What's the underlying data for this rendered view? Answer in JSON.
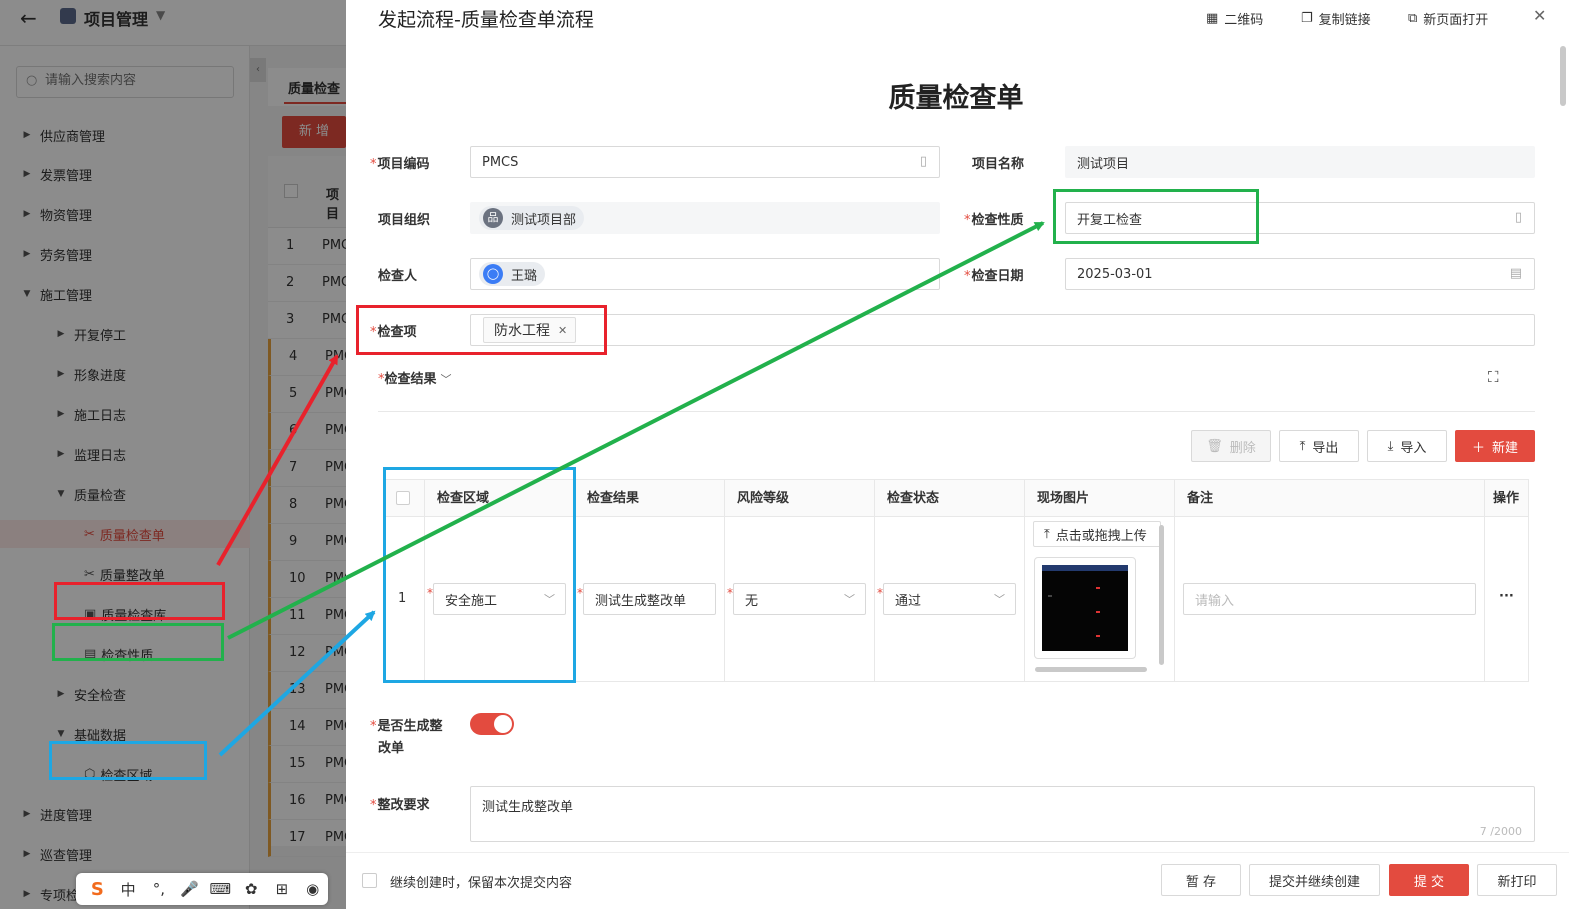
{
  "app": {
    "back_icon": "arrow-left-icon",
    "title": "项目管理",
    "search_placeholder": "请输入搜索内容",
    "tab_label": "质量检查",
    "new_button": "新 增",
    "table_header_col": "项目",
    "row_prefix": "PMC",
    "rows": [
      "1",
      "2",
      "3",
      "4",
      "5",
      "6",
      "7",
      "8",
      "9",
      "10",
      "11",
      "12",
      "13",
      "14",
      "15",
      "16",
      "17"
    ],
    "nav": [
      {
        "label": "供应商管理",
        "level": 0,
        "state": "collapsed"
      },
      {
        "label": "发票管理",
        "level": 0,
        "state": "collapsed"
      },
      {
        "label": "物资管理",
        "level": 0,
        "state": "collapsed"
      },
      {
        "label": "劳务管理",
        "level": 0,
        "state": "collapsed"
      },
      {
        "label": "施工管理",
        "level": 0,
        "state": "expanded"
      },
      {
        "label": "开复停工",
        "level": 1,
        "state": "collapsed"
      },
      {
        "label": "形象进度",
        "level": 1,
        "state": "collapsed"
      },
      {
        "label": "施工日志",
        "level": 1,
        "state": "collapsed"
      },
      {
        "label": "监理日志",
        "level": 1,
        "state": "collapsed"
      },
      {
        "label": "质量检查",
        "level": 1,
        "state": "expanded"
      },
      {
        "label": "质量检查单",
        "level": 2,
        "state": "active",
        "icon": "tools-icon"
      },
      {
        "label": "质量整改单",
        "level": 2,
        "state": "leaf",
        "icon": "tools-icon"
      },
      {
        "label": "质量检查库",
        "level": 2,
        "state": "leaf",
        "icon": "library-icon"
      },
      {
        "label": "检查性质",
        "level": 2,
        "state": "leaf",
        "icon": "clipboard-icon"
      },
      {
        "label": "安全检查",
        "level": 1,
        "state": "collapsed"
      },
      {
        "label": "基础数据",
        "level": 1,
        "state": "expanded"
      },
      {
        "label": "检查区域",
        "level": 2,
        "state": "leaf",
        "icon": "cube-icon"
      },
      {
        "label": "进度管理",
        "level": 0,
        "state": "collapsed"
      },
      {
        "label": "巡查管理",
        "level": 0,
        "state": "collapsed"
      },
      {
        "label": "专项检",
        "level": 0,
        "state": "collapsed"
      }
    ]
  },
  "ime": [
    "S",
    "中",
    "°,",
    "🎤",
    "⌨",
    "✿",
    "⊞",
    "◉"
  ],
  "drawer": {
    "title": "发起流程-质量检查单流程",
    "actions": [
      {
        "icon": "qrcode-icon",
        "label": "二维码"
      },
      {
        "icon": "copy-link-icon",
        "label": "复制链接"
      },
      {
        "icon": "open-new-page-icon",
        "label": "新页面打开"
      }
    ],
    "close_icon": "close-icon"
  },
  "form": {
    "title": "质量检查单",
    "fields": {
      "project_code": {
        "label": "项目编码",
        "value": "PMCS",
        "required": true
      },
      "project_name": {
        "label": "项目名称",
        "value": "测试项目",
        "required": false
      },
      "project_org": {
        "label": "项目组织",
        "value": "测试项目部",
        "required": false
      },
      "inspect_nature": {
        "label": "检查性质",
        "value": "开复工检查",
        "required": true
      },
      "inspector": {
        "label": "检查人",
        "value": "王璐",
        "required": false
      },
      "inspect_date": {
        "label": "检查日期",
        "value": "2025-03-01",
        "required": true
      },
      "inspect_item": {
        "label": "检查项",
        "tag": "防水工程",
        "required": true
      }
    },
    "result_section": {
      "label": "检查结果",
      "toolbar": {
        "delete": "删除",
        "export": "导出",
        "import": "导入",
        "new": "新建"
      },
      "columns": [
        "检查区域",
        "检查结果",
        "风险等级",
        "检查状态",
        "现场图片",
        "备注",
        "操作"
      ],
      "rows": [
        {
          "index": "1",
          "area": "安全施工",
          "result": "测试生成整改单",
          "risk": "无",
          "status": "通过",
          "upload": "点击或拖拽上传",
          "remark_placeholder": "请输入",
          "op": "···"
        }
      ]
    },
    "gen_rectify": {
      "label_line1": "是否生成整",
      "label_line2": "改单",
      "on": true
    },
    "rectify_req": {
      "label": "整改要求",
      "value": "测试生成整改单",
      "count": "7 /2000"
    }
  },
  "footer": {
    "continue_label": "继续创建时，保留本次提交内容",
    "buttons": {
      "save": "暂 存",
      "submit_continue": "提交并继续创建",
      "submit": "提 交",
      "print": "新打印"
    }
  },
  "colors": {
    "accent": "#e34b3f",
    "red_box": "#e8222c",
    "green_box": "#22b14c",
    "blue_box": "#1ea7e3"
  }
}
